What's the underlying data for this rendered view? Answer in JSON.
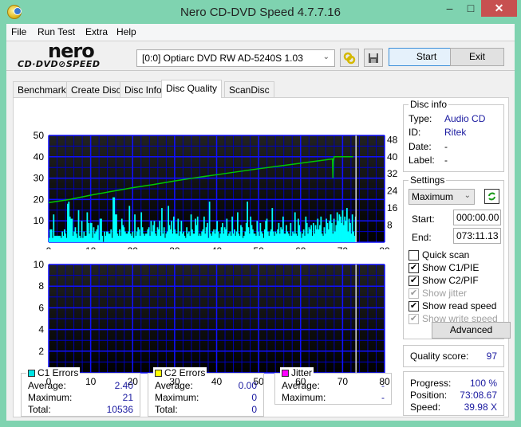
{
  "window": {
    "title": "Nero CD-DVD Speed 4.7.7.16",
    "min": "–",
    "max": "□",
    "close": "✕"
  },
  "menu": [
    "File",
    "Run Test",
    "Extra",
    "Help"
  ],
  "logo": {
    "top": "nero",
    "bottom": "CD·DVD⊘SPEED"
  },
  "toolbar": {
    "drive": "[0:0]   Optiarc DVD RW AD-5240S 1.03",
    "start": "Start",
    "exit": "Exit"
  },
  "tabs": [
    "Benchmark",
    "Create Disc",
    "Disc Info",
    "Disc Quality",
    "ScanDisc"
  ],
  "disc_info": {
    "title": "Disc info",
    "type_label": "Type:",
    "type": "Audio CD",
    "id_label": "ID:",
    "id": "Ritek",
    "date_label": "Date:",
    "date": "-",
    "label_label": "Label:",
    "label": "-"
  },
  "settings": {
    "title": "Settings",
    "speed": "Maximum",
    "start_label": "Start:",
    "start": "000:00.00",
    "end_label": "End:",
    "end": "073:11.13",
    "checks": [
      {
        "label": "Quick scan",
        "checked": false,
        "enabled": true
      },
      {
        "label": "Show C1/PIE",
        "checked": true,
        "enabled": true
      },
      {
        "label": "Show C2/PIF",
        "checked": true,
        "enabled": true
      },
      {
        "label": "Show jitter",
        "checked": true,
        "enabled": false
      },
      {
        "label": "Show read speed",
        "checked": true,
        "enabled": true
      },
      {
        "label": "Show write speed",
        "checked": true,
        "enabled": false
      }
    ],
    "advanced": "Advanced"
  },
  "quality": {
    "label": "Quality score:",
    "value": "97"
  },
  "progress": {
    "progress_label": "Progress:",
    "progress": "100 %",
    "position_label": "Position:",
    "position": "73:08.67",
    "speed_label": "Speed:",
    "speed": "39.98 X"
  },
  "c1": {
    "title": "C1 Errors",
    "color": "#00e5e5",
    "avg_label": "Average:",
    "avg": "2.40",
    "max_label": "Maximum:",
    "max": "21",
    "total_label": "Total:",
    "total": "10536"
  },
  "c2": {
    "title": "C2 Errors",
    "color": "#ffff00",
    "avg_label": "Average:",
    "avg": "0.00",
    "max_label": "Maximum:",
    "max": "0",
    "total_label": "Total:",
    "total": "0"
  },
  "jitter": {
    "title": "Jitter",
    "color": "#ff00ff",
    "avg_label": "Average:",
    "avg": "-",
    "max_label": "Maximum:",
    "max": "-"
  },
  "chart_data": [
    {
      "type": "bar",
      "title": "C1 errors / read speed",
      "x_ticks": [
        "0",
        "10",
        "20",
        "30",
        "40",
        "50",
        "60",
        "70",
        "80"
      ],
      "y_ticks_left": [
        "50",
        "40",
        "30",
        "20",
        "10"
      ],
      "y_ticks_right": [
        "48",
        "40",
        "32",
        "24",
        "16",
        "8"
      ],
      "xlim": [
        0,
        80
      ],
      "ylim": [
        0,
        50
      ],
      "y2lim": [
        0,
        50
      ],
      "end_marker": 73.2,
      "series": [
        {
          "name": "C1 errors",
          "color": "#00ffff",
          "values": [
            2,
            6,
            6,
            2,
            13,
            3,
            3,
            3,
            3,
            3,
            3,
            2,
            5,
            3,
            6,
            4,
            2,
            18,
            19,
            12,
            11,
            11,
            3,
            5,
            7,
            4,
            2,
            15,
            3,
            2,
            10,
            2,
            5,
            3,
            3,
            14,
            9,
            4,
            9,
            9,
            2,
            7,
            4,
            5,
            6,
            8,
            1,
            11,
            11,
            3,
            0,
            5,
            3,
            5,
            5,
            4,
            4,
            6,
            2,
            21,
            21,
            13,
            13,
            4,
            3,
            6,
            3,
            11,
            8,
            7,
            5,
            4,
            4,
            5,
            17,
            4,
            3,
            5,
            2,
            13,
            3,
            5,
            7,
            6,
            3,
            14,
            7,
            4,
            3,
            4,
            4,
            6,
            7,
            3,
            10,
            5,
            8,
            10,
            4,
            3,
            7,
            6,
            10,
            3,
            16,
            4,
            7,
            2,
            4,
            5,
            17,
            8,
            6,
            10,
            4,
            12,
            6,
            4,
            4,
            11,
            3,
            5,
            10,
            4,
            5,
            3,
            2,
            7,
            4,
            5,
            3,
            13,
            6,
            4,
            4,
            11,
            8,
            12,
            3,
            4,
            3,
            5,
            6,
            12,
            4,
            7,
            9,
            2,
            19,
            4,
            3,
            5,
            6,
            4,
            6,
            10,
            5,
            2,
            4,
            7,
            9,
            4,
            7,
            6,
            11,
            3,
            4,
            5,
            3,
            12,
            4,
            6,
            3,
            5,
            14,
            4,
            3,
            8,
            7,
            2,
            3,
            5,
            9,
            19,
            7,
            4,
            12,
            8,
            6,
            4,
            4,
            3,
            10,
            5,
            3,
            9,
            5,
            4,
            2,
            6,
            10,
            11,
            5,
            3,
            5,
            6,
            16,
            5,
            3,
            5,
            4,
            6,
            9,
            4,
            7,
            6,
            12,
            4,
            4,
            8,
            5,
            4,
            3,
            9,
            3,
            5,
            4,
            14,
            4,
            3,
            11,
            8,
            5,
            2,
            4,
            6,
            3,
            12,
            9,
            4,
            7,
            6,
            8,
            3,
            9,
            4,
            8,
            6,
            11,
            6,
            8,
            12,
            4,
            3,
            7,
            4,
            11,
            9,
            6,
            10,
            13,
            9,
            4,
            11,
            5,
            8,
            14,
            10,
            13,
            12,
            9,
            15,
            8,
            12,
            10,
            16,
            5,
            11,
            9,
            4,
            13,
            5,
            3,
            12
          ]
        },
        {
          "name": "Read speed (X)",
          "color": "#00c800",
          "points": [
            [
              0,
              18.5
            ],
            [
              5,
              20
            ],
            [
              10,
              22
            ],
            [
              15,
              23.8
            ],
            [
              20,
              25.5
            ],
            [
              25,
              27
            ],
            [
              30,
              28.7
            ],
            [
              35,
              30.2
            ],
            [
              40,
              31.6
            ],
            [
              45,
              33
            ],
            [
              50,
              34.4
            ],
            [
              55,
              35.7
            ],
            [
              60,
              37
            ],
            [
              65,
              38.3
            ],
            [
              67.6,
              39
            ],
            [
              67.7,
              30
            ],
            [
              67.8,
              38
            ],
            [
              68,
              40
            ],
            [
              72.5,
              40
            ]
          ]
        }
      ]
    },
    {
      "type": "bar",
      "title": "C2 errors / jitter",
      "x_ticks": [
        "0",
        "10",
        "20",
        "30",
        "40",
        "50",
        "60",
        "70",
        "80"
      ],
      "y_ticks_left": [
        "10",
        "8",
        "6",
        "4",
        "2"
      ],
      "xlim": [
        0,
        80
      ],
      "ylim": [
        0,
        10
      ],
      "end_marker": 73.2,
      "series": [
        {
          "name": "C2 errors",
          "color": "#ffff00",
          "values": []
        }
      ]
    }
  ]
}
